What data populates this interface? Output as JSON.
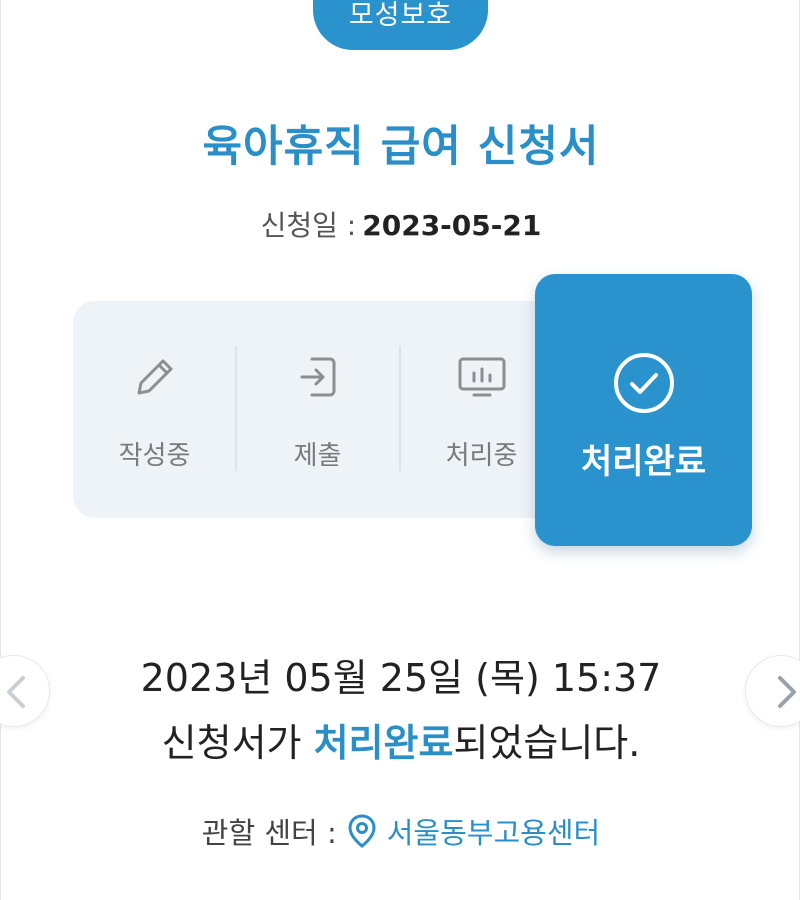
{
  "card": {
    "category_tag": "모성보호",
    "title": "육아휴직 급여 신청서",
    "date_label": "신청일 :",
    "date_value": "2023-05-21"
  },
  "steps": [
    {
      "label": "작성중",
      "icon": "pencil-icon"
    },
    {
      "label": "제출",
      "icon": "submit-icon"
    },
    {
      "label": "처리중",
      "icon": "processing-monitor-icon"
    },
    {
      "label": "처리완료",
      "icon": "check-circle-icon",
      "active": true
    }
  ],
  "message": {
    "datetime": "2023년 05월 25일 (목) 15:37",
    "prefix": "신청서가 ",
    "highlight": "처리완료",
    "suffix": "되었습니다."
  },
  "center": {
    "label": "관할 센터 :",
    "value": "서울동부고용센터",
    "icon": "location-pin-icon"
  },
  "colors": {
    "accent": "#2a92cc",
    "accent_text": "#2a8fc8",
    "step_bg": "#eef3f8"
  }
}
